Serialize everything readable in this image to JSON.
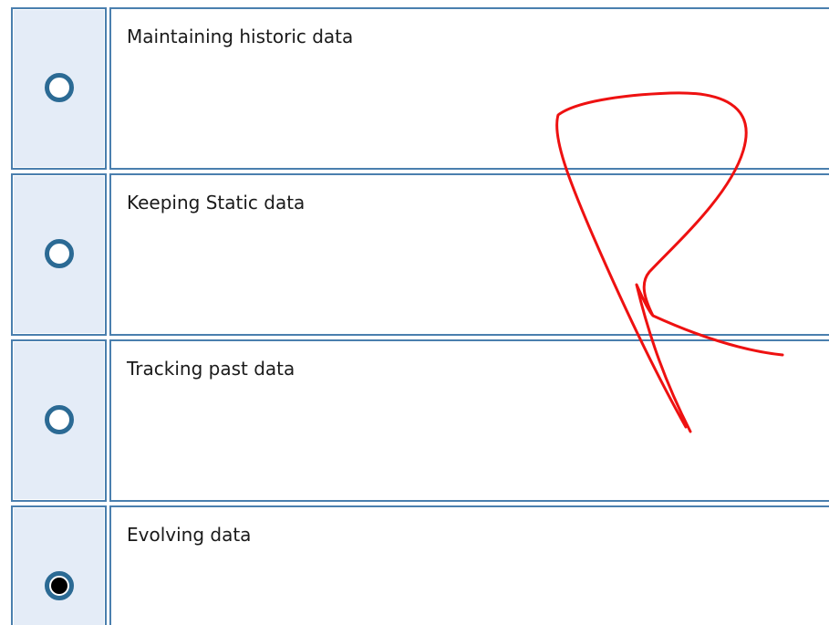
{
  "question": {
    "options": [
      {
        "label": "Maintaining historic data",
        "selected": false
      },
      {
        "label": "Keeping Static data",
        "selected": false
      },
      {
        "label": "Tracking past data",
        "selected": false
      },
      {
        "label": "Evolving data",
        "selected": true
      }
    ]
  },
  "colors": {
    "cell_border": "#4a7fae",
    "radio_cell_bg": "#e4ecf7",
    "radio_ring": "#2b6a94",
    "annotation_stroke": "#ee1111"
  },
  "annotation": {
    "type": "freehand-mark"
  }
}
